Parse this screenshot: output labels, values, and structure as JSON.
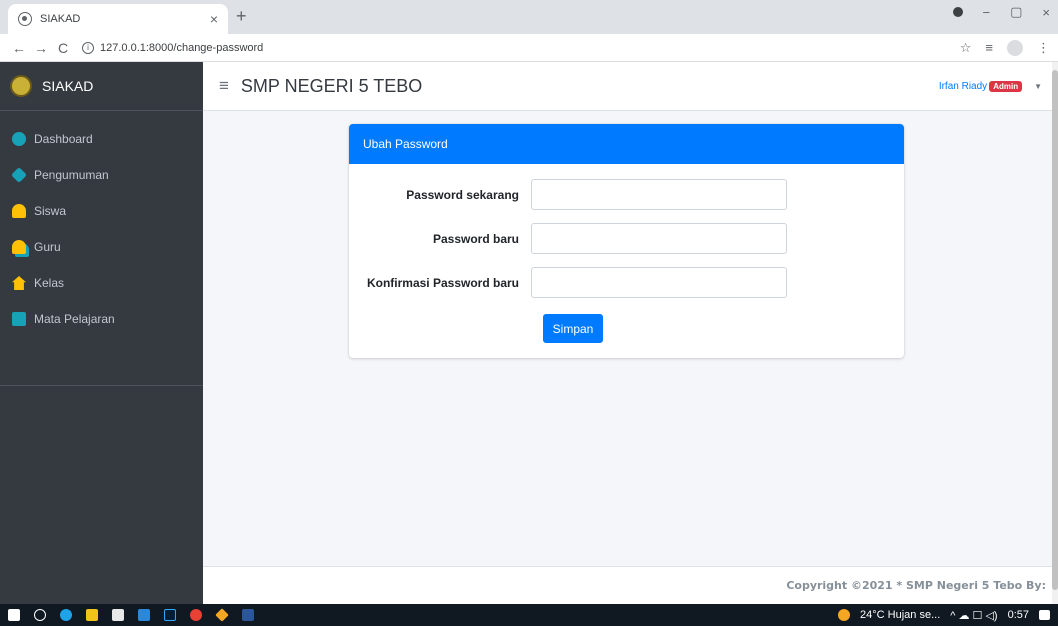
{
  "browser": {
    "tab_title": "SIAKAD",
    "tab_close": "×",
    "new_tab": "+",
    "url": "127.0.0.1:8000/change-password",
    "back": "←",
    "forward": "→",
    "reload": "C",
    "star": "☆",
    "reading_list": "≡",
    "menu": "⋮",
    "minimize": "−",
    "restore": "▢",
    "close": "×"
  },
  "sidebar": {
    "brand": "SIAKAD",
    "items": [
      {
        "label": "Dashboard",
        "icon": "dashboard-icon"
      },
      {
        "label": "Pengumuman",
        "icon": "bullhorn-icon"
      },
      {
        "label": "Siswa",
        "icon": "user-icon"
      },
      {
        "label": "Guru",
        "icon": "teacher-icon"
      },
      {
        "label": "Kelas",
        "icon": "school-icon"
      },
      {
        "label": "Mata Pelajaran",
        "icon": "table-icon"
      }
    ]
  },
  "topnav": {
    "hamburger": "≡",
    "school_name": "SMP NEGERI 5 TEBO",
    "user_name": "Irfan Riady",
    "user_badge": "Admin",
    "caret": "▼"
  },
  "card": {
    "title": "Ubah Password",
    "fields": [
      {
        "label": "Password sekarang",
        "value": ""
      },
      {
        "label": "Password baru",
        "value": ""
      },
      {
        "label": "Konfirmasi Password baru",
        "value": ""
      }
    ],
    "submit_label": "Simpan"
  },
  "footer": {
    "copyright": "Copyright ©2021 * SMP Negeri 5 Tebo By:"
  },
  "taskbar": {
    "weather": "24°C Hujan se...",
    "tray": "^ ☁ ☐ ◁)",
    "time": "0:57"
  },
  "colors": {
    "primary": "#007bff",
    "sidebar": "#343a40",
    "badge": "#dc3545"
  }
}
